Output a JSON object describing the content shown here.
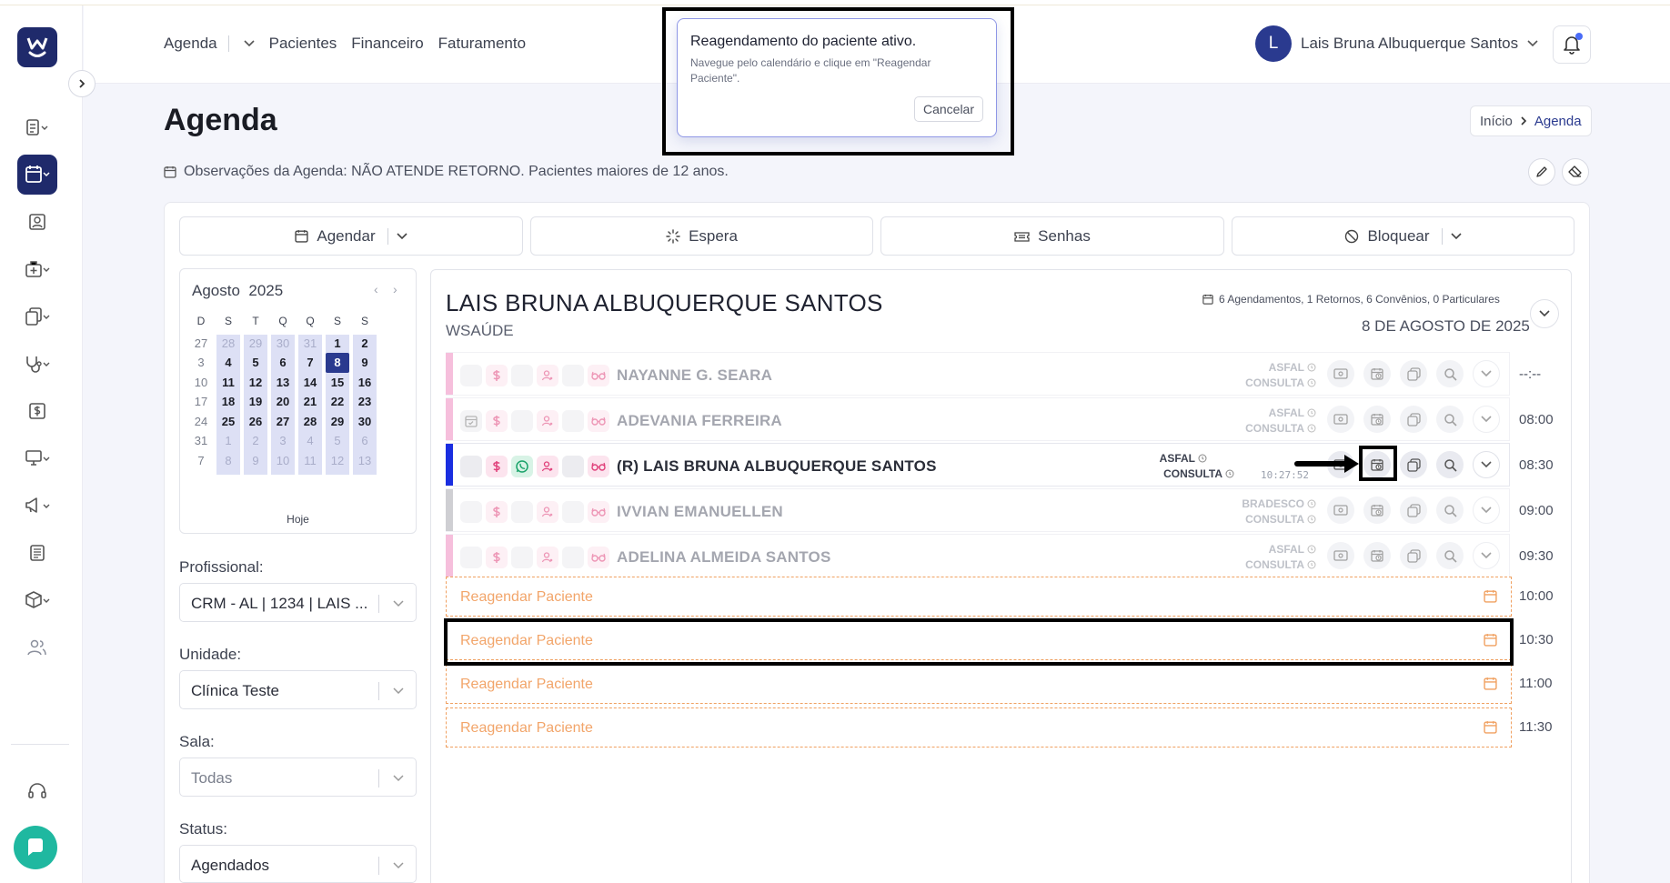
{
  "nav": {
    "items": [
      "Agenda",
      "Pacientes",
      "Financeiro",
      "Faturamento"
    ]
  },
  "user": {
    "initial": "L",
    "name": "Lais Bruna Albuquerque Santos"
  },
  "toast": {
    "title": "Reagendamento do paciente ativo.",
    "message": "Navegue pelo calendário e clique em \"Reagendar Paciente\".",
    "cancel_label": "Cancelar"
  },
  "page": {
    "title": "Agenda",
    "breadcrumb_home": "Início",
    "breadcrumb_current": "Agenda",
    "observations": "Observações da Agenda: NÃO ATENDE RETORNO. Pacientes maiores de 12 anos."
  },
  "actions": {
    "schedule": "Agendar",
    "wait": "Espera",
    "tickets": "Senhas",
    "block": "Bloquear"
  },
  "calendar": {
    "month": "Agosto",
    "year": "2025",
    "weekdays": [
      "D",
      "S",
      "T",
      "Q",
      "Q",
      "S",
      "S"
    ],
    "weeks": [
      [
        "27",
        "28",
        "29",
        "30",
        "31",
        "1",
        "2"
      ],
      [
        "3",
        "4",
        "5",
        "6",
        "7",
        "8",
        "9"
      ],
      [
        "10",
        "11",
        "12",
        "13",
        "14",
        "15",
        "16"
      ],
      [
        "17",
        "18",
        "19",
        "20",
        "21",
        "22",
        "23"
      ],
      [
        "24",
        "25",
        "26",
        "27",
        "28",
        "29",
        "30"
      ],
      [
        "31",
        "1",
        "2",
        "3",
        "4",
        "5",
        "6"
      ],
      [
        "7",
        "8",
        "9",
        "10",
        "11",
        "12",
        "13"
      ]
    ],
    "selected_day": "8",
    "today_label": "Hoje"
  },
  "filters": {
    "professional_label": "Profissional:",
    "professional_value": "CRM - AL | 1234 | LAIS ...",
    "unit_label": "Unidade:",
    "unit_value": "Clínica Teste",
    "room_label": "Sala:",
    "room_value": "Todas",
    "status_label": "Status:",
    "status_value": "Agendados"
  },
  "schedule": {
    "professional_name": "LAIS BRUNA ALBUQUERQUE SANTOS",
    "clinic": "WSAÚDE",
    "stats": "6 Agendamentos, 1 Retornos, 6 Convênios, 0 Particulares",
    "date": "8 DE AGOSTO DE 2025",
    "appointments": [
      {
        "name": "NAYANNE G. SEARA",
        "insurance": "ASFAL",
        "type": "CONSULTA",
        "time": "--:--",
        "bar": "#f08cc0",
        "active": false
      },
      {
        "name": "ADEVANIA FERREIRA",
        "insurance": "ASFAL",
        "type": "CONSULTA",
        "time": "08:00",
        "bar": "#f08cc0",
        "active": false
      },
      {
        "name": "(R) LAIS BRUNA ALBUQUERQUE SANTOS",
        "insurance": "ASFAL",
        "type": "CONSULTA",
        "clock": "10:27:52",
        "time": "08:30",
        "bar": "#1a2ee0",
        "active": true
      },
      {
        "name": "IVVIAN EMANUELLEN",
        "insurance": "BRADESCO",
        "type": "CONSULTA",
        "time": "09:00",
        "bar": "#a8a8b0",
        "active": false
      },
      {
        "name": "ADELINA ALMEIDA SANTOS",
        "insurance": "ASFAL",
        "type": "CONSULTA",
        "time": "09:30",
        "bar": "#f08cc0",
        "active": false
      }
    ],
    "reschedule_slots": [
      {
        "label": "Reagendar Paciente",
        "time": "10:00"
      },
      {
        "label": "Reagendar Paciente",
        "time": "10:30"
      },
      {
        "label": "Reagendar Paciente",
        "time": "11:00"
      },
      {
        "label": "Reagendar Paciente",
        "time": "11:30"
      }
    ]
  },
  "colors": {
    "brand": "#1f2a6b",
    "accent": "#2a3a8f",
    "reschedule": "#f0a060",
    "highlight": "#dde0f5"
  }
}
